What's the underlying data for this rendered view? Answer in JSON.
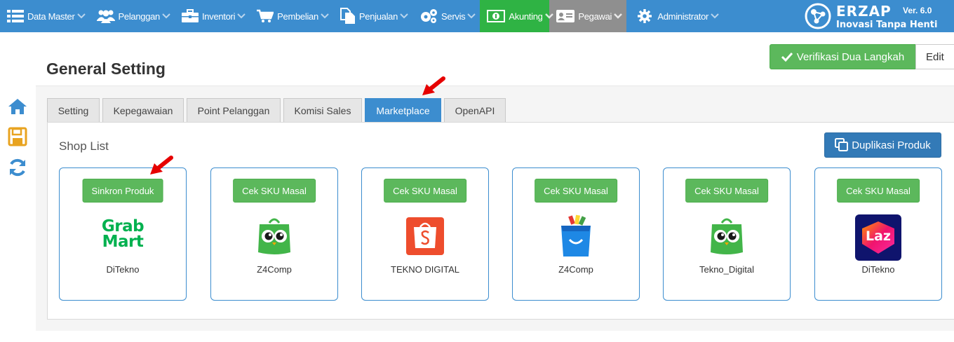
{
  "nav": {
    "items": [
      {
        "label": "Data Master",
        "icon": "list-icon"
      },
      {
        "label": "Pelanggan",
        "icon": "users-icon"
      },
      {
        "label": "Inventori",
        "icon": "briefcase-icon"
      },
      {
        "label": "Pembelian",
        "icon": "cart-icon"
      },
      {
        "label": "Penjualan",
        "icon": "documents-icon"
      },
      {
        "label": "Servis",
        "icon": "gears-icon"
      },
      {
        "label": "Akunting",
        "icon": "money-icon"
      },
      {
        "label": "Pegawai",
        "icon": "id-card-icon"
      },
      {
        "label": "Administrator",
        "icon": "gear-icon"
      }
    ],
    "active_green": "#2fb344",
    "active_gray": "#8f8f8f",
    "bar_color": "#3c8dcf"
  },
  "brand": {
    "name": "ERZAP",
    "version": "Ver. 6.0",
    "tagline": "Inovasi Tanpa Henti"
  },
  "sidebar": {
    "icons": [
      "home-icon",
      "save-icon",
      "refresh-icon"
    ]
  },
  "header": {
    "title": "General Setting",
    "verif_label": "Verifikasi Dua Langkah",
    "edit_label": "Edit"
  },
  "tabs": [
    {
      "label": "Setting",
      "active": false
    },
    {
      "label": "Kepegawaian",
      "active": false
    },
    {
      "label": "Point Pelanggan",
      "active": false
    },
    {
      "label": "Komisi Sales",
      "active": false
    },
    {
      "label": "Marketplace",
      "active": true
    },
    {
      "label": "OpenAPI",
      "active": false
    }
  ],
  "shop_list": {
    "title": "Shop List",
    "duplicate_label": "Duplikasi Produk",
    "shops": [
      {
        "button": "Sinkron Produk",
        "name": "DiTekno",
        "logo": "grabmart-logo",
        "logo_text": [
          "Grab",
          "Mart"
        ]
      },
      {
        "button": "Cek SKU Masal",
        "name": "Z4Comp",
        "logo": "tokopedia-logo"
      },
      {
        "button": "Cek SKU Masal",
        "name": "TEKNO DIGITAL",
        "logo": "shopee-logo"
      },
      {
        "button": "Cek SKU Masal",
        "name": "Z4Comp",
        "logo": "blibli-logo"
      },
      {
        "button": "Cek SKU Masal",
        "name": "Tekno_Digital",
        "logo": "tokopedia-logo"
      },
      {
        "button": "Cek SKU Masal",
        "name": "DiTekno",
        "logo": "lazada-logo",
        "logo_text": [
          "Laz"
        ]
      }
    ]
  }
}
